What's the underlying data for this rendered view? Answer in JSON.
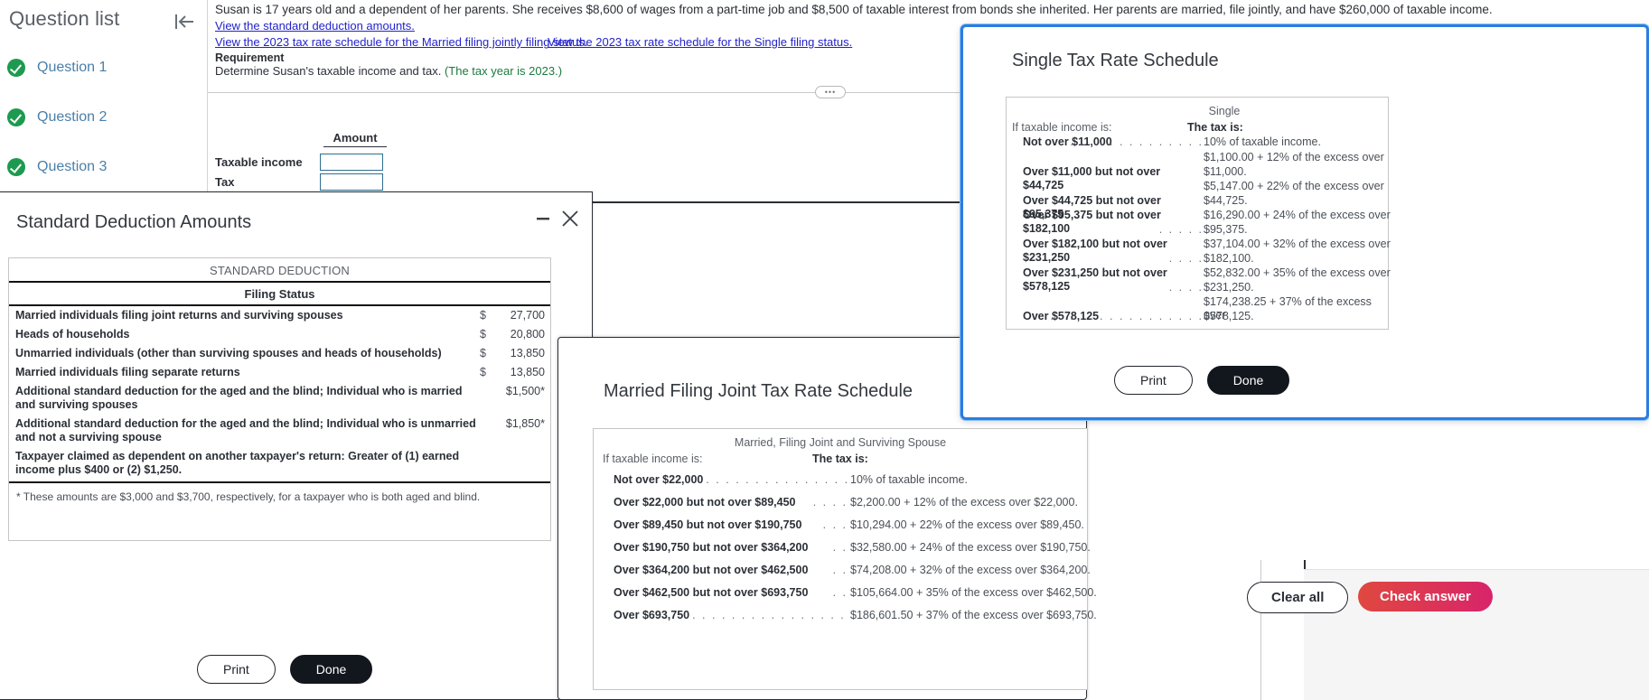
{
  "sidebar": {
    "title": "Question list",
    "collapse_icon": "collapse-left-icon",
    "items": [
      {
        "label": "Question 1",
        "status_icon": "check-circle-icon"
      },
      {
        "label": "Question 2",
        "status_icon": "check-circle-icon"
      },
      {
        "label": "Question 3",
        "status_icon": "check-circle-icon"
      }
    ]
  },
  "problem": {
    "text": "Susan is 17 years old and a dependent of her parents. She receives $8,600 of wages from a part-time job and $8,500 of taxable interest from bonds she inherited. Her parents are married, file jointly, and have $260,000 of taxable income.",
    "links": [
      "View the standard deduction amounts.",
      "View the 2023 tax rate schedule for the Married filing jointly filing status.",
      "View the 2023 tax rate schedule for the Single filing status."
    ],
    "requirement_heading": "Requirement",
    "requirement_text": "Determine Susan's taxable income and tax.",
    "requirement_year": "(The tax year is 2023.)",
    "handle_dots": "•••"
  },
  "answer_table": {
    "amount_header": "Amount",
    "rows": [
      {
        "label": "Taxable income",
        "value": ""
      },
      {
        "label": "Tax",
        "value": ""
      }
    ]
  },
  "standard_deduction_dialog": {
    "title": "Standard Deduction Amounts",
    "minimize_icon": "minimize-icon",
    "close_icon": "close-icon",
    "caption": "STANDARD DEDUCTION",
    "subheader": "Filing Status",
    "rows": [
      {
        "name": "Married individuals filing joint returns and surviving spouses",
        "dollar": "$",
        "amount": "27,700"
      },
      {
        "name": "Heads of households",
        "dollar": "$",
        "amount": "20,800"
      },
      {
        "name": "Unmarried individuals (other than surviving spouses and heads of households)",
        "dollar": "$",
        "amount": "13,850"
      },
      {
        "name": "Married individuals filing separate returns",
        "dollar": "$",
        "amount": "13,850"
      },
      {
        "name": "Additional standard deduction for the aged and the blind; Individual who is married and surviving spouses",
        "dollar": "",
        "amount": "$1,500*"
      },
      {
        "name": "Additional standard deduction for the aged and the blind; Individual who is unmarried and not a surviving spouse",
        "dollar": "",
        "amount": "$1,850*"
      },
      {
        "name": "Taxpayer claimed as dependent on another taxpayer's return: Greater of (1) earned income plus $400 or (2) $1,250.",
        "dollar": "",
        "amount": ""
      }
    ],
    "footnote": "* These amounts are $3,000 and $3,700, respectively, for a taxpayer who is both aged and blind.",
    "print_label": "Print",
    "done_label": "Done"
  },
  "married_filing_joint_dialog": {
    "title": "Married Filing Joint Tax Rate Schedule",
    "caption": "Married, Filing Joint and Surviving Spouse",
    "col_left_header": "If taxable income is:",
    "col_right_header": "The tax is:",
    "rows": [
      {
        "range": "Not over $22,000",
        "dots": ". . . . . . . . . . . . . . . . .",
        "tax": "10% of taxable income."
      },
      {
        "range": "Over $22,000 but not over $89,450",
        "dots": ". . . .",
        "tax": "$2,200.00 + 12% of the excess over $22,000."
      },
      {
        "range": "Over $89,450 but not over $190,750",
        "dots": ". . .",
        "tax": "$10,294.00 + 22% of the excess over $89,450."
      },
      {
        "range": "Over $190,750 but not over $364,200",
        "dots": ". .",
        "tax": "$32,580.00 + 24% of the excess over $190,750."
      },
      {
        "range": "Over $364,200 but not over $462,500",
        "dots": ". .",
        "tax": "$74,208.00 + 32% of the excess over $364,200."
      },
      {
        "range": "Over $462,500 but not over $693,750",
        "dots": ". .",
        "tax": "$105,664.00 + 35% of the excess over $462,500."
      },
      {
        "range": "Over $693,750",
        "dots": ". . . . . . . . . . . . . . . . . .",
        "tax": "$186,601.50 + 37% of the excess over $693,750."
      }
    ]
  },
  "single_dialog": {
    "title": "Single Tax Rate Schedule",
    "minimize_icon": "minimize-icon",
    "close_icon": "close-icon",
    "caption": "Single",
    "col_left_header": "If taxable income is:",
    "col_right_header": "The tax is:",
    "rows": [
      {
        "left": "Not over $11,000",
        "dots": ". . . . . . . . . . . . . .",
        "right": "10% of taxable income.",
        "right2": ""
      },
      {
        "left": "Over $11,000 but not over $44,725",
        "dots": "",
        "right": "$1,100.00 + 12% of the excess over",
        "right2": "$11,000."
      },
      {
        "left": "Over $44,725 but not over $95,375",
        "dots": "",
        "right": "$5,147.00 + 22% of the excess over",
        "right2": "$44,725."
      },
      {
        "left": "Over $95,375 but not over $182,100",
        "dots": ". . . . .",
        "right": "$16,290.00 + 24% of the excess over",
        "right2": "$95,375."
      },
      {
        "left": "Over $182,100 but not over $231,250",
        "dots": ". . . .",
        "right": "$37,104.00 + 32% of the excess over",
        "right2": "$182,100."
      },
      {
        "left": "Over $231,250 but not over $578,125",
        "dots": ". . . .",
        "right": "$52,832.00 + 35% of the excess over",
        "right2": "$231,250."
      },
      {
        "left": "Over $578,125",
        "dots": ". . . . . . . . . . . . . . . .",
        "right": "$174,238.25 + 37% of the excess over",
        "right2": "$578,125."
      }
    ],
    "print_label": "Print",
    "done_label": "Done",
    "accent_color": "#2b7de0"
  },
  "actions": {
    "clear_all_label": "Clear all",
    "check_answer_label": "Check answer",
    "check_color": "#d8246b"
  }
}
